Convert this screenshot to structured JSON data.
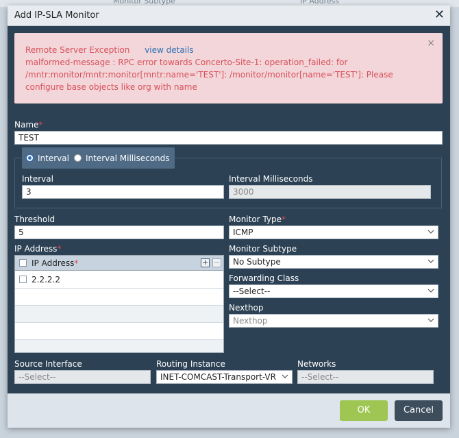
{
  "background": {
    "monitor_subtype_header": "Monitor Subtype",
    "ip_address_header": "IP Address"
  },
  "modal": {
    "title": "Add IP-SLA Monitor",
    "close_icon": "close-icon"
  },
  "alert": {
    "heading": "Remote Server Exception",
    "link": "view details",
    "message": "malformed-message : RPC error towards Concerto-Site-1: operation_failed: for /mntr:monitor/mntr:monitor[mntr:name='TEST']: /monitor/monitor[name='TEST']: Please configure base objects like org with name",
    "close": "×"
  },
  "name": {
    "label": "Name",
    "required": "*",
    "value": "TEST"
  },
  "interval_mode": {
    "options": [
      "Interval",
      "Interval Milliseconds"
    ],
    "selected": "Interval"
  },
  "interval": {
    "label": "Interval",
    "value": "3"
  },
  "interval_ms": {
    "label": "Interval Milliseconds",
    "value": "3000"
  },
  "threshold": {
    "label": "Threshold",
    "value": "5"
  },
  "monitor_type": {
    "label": "Monitor Type",
    "required": "*",
    "value": "ICMP"
  },
  "ip_address": {
    "label": "IP Address",
    "required": "*",
    "column": "IP Address",
    "rows": [
      "2.2.2.2"
    ],
    "add": "+",
    "remove": "−"
  },
  "monitor_subtype": {
    "label": "Monitor Subtype",
    "value": "No Subtype"
  },
  "forwarding_class": {
    "label": "Forwarding Class",
    "value": "--Select--"
  },
  "nexthop": {
    "label": "Nexthop",
    "placeholder": "Nexthop"
  },
  "source_interface": {
    "label": "Source Interface",
    "value": "--Select--"
  },
  "routing_instance": {
    "label": "Routing Instance",
    "value": "INET-COMCAST-Transport-VR"
  },
  "networks": {
    "label": "Networks",
    "value": "--Select--"
  },
  "footer": {
    "ok": "OK",
    "cancel": "Cancel"
  },
  "colors": {
    "modal_bg": "#2c4154",
    "alert_bg": "#f2d6d9",
    "alert_text": "#d9505a",
    "link": "#2d6fb4",
    "ok_button": "#9fc653",
    "cancel_button": "#3d4d5c",
    "required": "#e0474f"
  }
}
